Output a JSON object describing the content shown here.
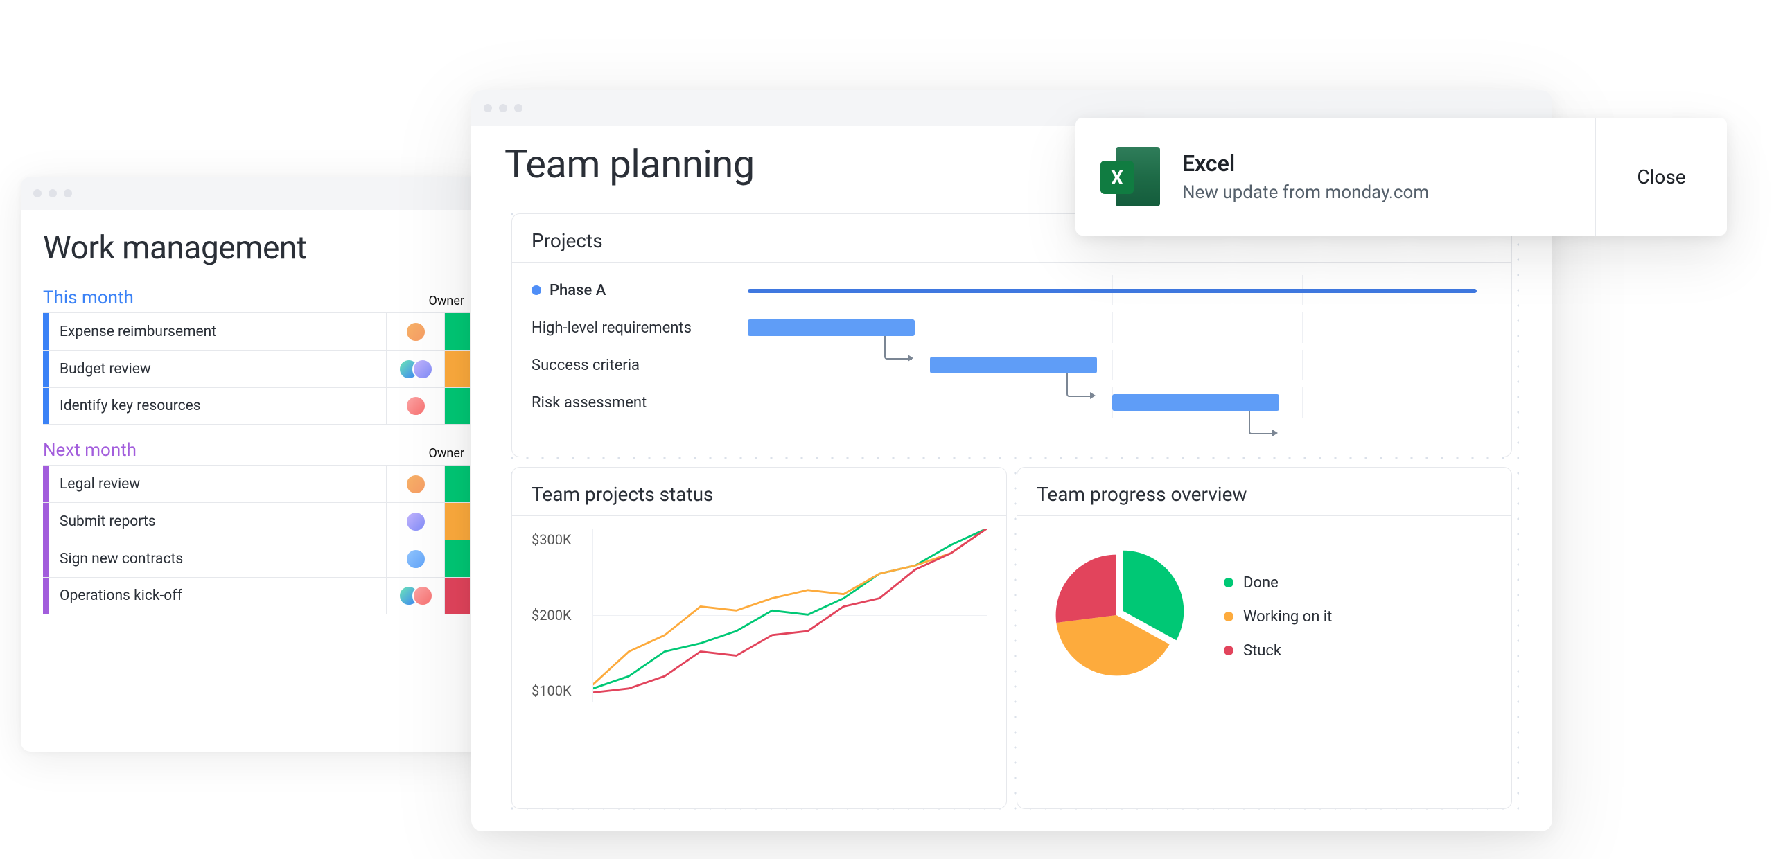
{
  "back_window": {
    "title": "Work management",
    "columns": {
      "owner": "Owner"
    },
    "groups": [
      {
        "name": "This month",
        "color": "blue",
        "tasks": [
          {
            "label": "Expense reimbursement",
            "status": "green",
            "owners": 1
          },
          {
            "label": "Budget review",
            "status": "orange",
            "owners": 2
          },
          {
            "label": "Identify key resources",
            "status": "green",
            "owners": 1
          }
        ]
      },
      {
        "name": "Next month",
        "color": "purple",
        "tasks": [
          {
            "label": "Legal review",
            "status": "green",
            "owners": 1
          },
          {
            "label": "Submit reports",
            "status": "orange",
            "owners": 1
          },
          {
            "label": "Sign new contracts",
            "status": "green",
            "owners": 1
          },
          {
            "label": "Operations kick-off",
            "status": "red",
            "owners": 2
          }
        ]
      }
    ]
  },
  "front_window": {
    "title": "Team planning",
    "projects_card": {
      "title": "Projects",
      "phase_label": "Phase A",
      "rows": [
        {
          "label": "High-level requirements",
          "start_pct": 2,
          "width_pct": 22
        },
        {
          "label": "Success criteria",
          "start_pct": 26,
          "width_pct": 22
        },
        {
          "label": "Risk assessment",
          "start_pct": 50,
          "width_pct": 22
        }
      ],
      "phase_line": {
        "start_pct": 2,
        "width_pct": 96
      }
    },
    "status_card": {
      "title": "Team projects status",
      "y_ticks": [
        "$300K",
        "$200K",
        "$100K"
      ]
    },
    "progress_card": {
      "title": "Team progress overview",
      "legend": [
        {
          "label": "Done",
          "color": "green"
        },
        {
          "label": "Working on it",
          "color": "orange"
        },
        {
          "label": "Stuck",
          "color": "red"
        }
      ]
    }
  },
  "toast": {
    "app": "Excel",
    "message": "New update from monday.com",
    "close": "Close"
  },
  "chart_data": [
    {
      "type": "bar",
      "note": "Gantt timeline inside Projects card — x is percent of timeline width",
      "series": [
        {
          "name": "Phase A (summary bar)",
          "start": 2,
          "end": 98
        },
        {
          "name": "High-level requirements",
          "start": 2,
          "end": 24
        },
        {
          "name": "Success criteria",
          "start": 26,
          "end": 48
        },
        {
          "name": "Risk assessment",
          "start": 50,
          "end": 72
        }
      ]
    },
    {
      "type": "line",
      "title": "Team projects status",
      "ylabel": "$",
      "ylim": [
        100000,
        300000
      ],
      "x": [
        0,
        1,
        2,
        3,
        4,
        5,
        6,
        7,
        8,
        9,
        10,
        11
      ],
      "series": [
        {
          "name": "green",
          "color": "#00c875",
          "values": [
            105,
            120,
            150,
            160,
            175,
            200,
            195,
            215,
            245,
            255,
            280,
            300
          ]
        },
        {
          "name": "orange",
          "color": "#fdab3d",
          "values": [
            110,
            150,
            170,
            205,
            200,
            215,
            225,
            220,
            245,
            255,
            270,
            300
          ]
        },
        {
          "name": "red",
          "color": "#e2445c",
          "values": [
            100,
            105,
            120,
            150,
            145,
            170,
            175,
            205,
            215,
            250,
            270,
            300
          ]
        }
      ],
      "value_unit": "thousand USD"
    },
    {
      "type": "pie",
      "title": "Team progress overview",
      "categories": [
        "Done",
        "Working on it",
        "Stuck"
      ],
      "values": [
        33,
        40,
        27
      ],
      "colors": [
        "#00c875",
        "#fdab3d",
        "#e2445c"
      ]
    }
  ]
}
